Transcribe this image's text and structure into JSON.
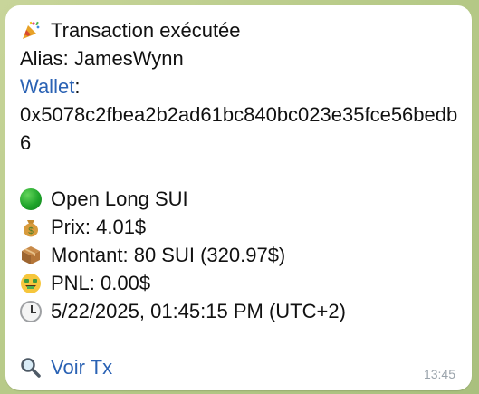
{
  "message": {
    "title": "Transaction exécutée",
    "alias_label": "Alias: JamesWynn",
    "wallet_link": "Wallet",
    "wallet_colon": ":",
    "wallet_address": "0x5078c2fbea2b2ad61bc840bc023e35fce56bedb6",
    "position": "Open Long SUI",
    "price": "Prix: 4.01$",
    "amount": "Montant: 80 SUI (320.97$)",
    "pnl": "PNL: 0.00$",
    "datetime": "5/22/2025, 01:45:15 PM (UTC+2)",
    "view_tx_link": "Voir Tx",
    "time": "13:45"
  },
  "icons": {
    "title": "party-popper-icon",
    "position": "green-circle-icon",
    "price": "money-bag-icon",
    "amount": "package-icon",
    "pnl": "money-mouth-face-icon",
    "datetime": "clock-icon",
    "view_tx": "magnifying-glass-icon"
  },
  "colors": {
    "link": "#2a62b4",
    "bubble": "#ffffff",
    "timestamp": "#9aa3ab"
  }
}
